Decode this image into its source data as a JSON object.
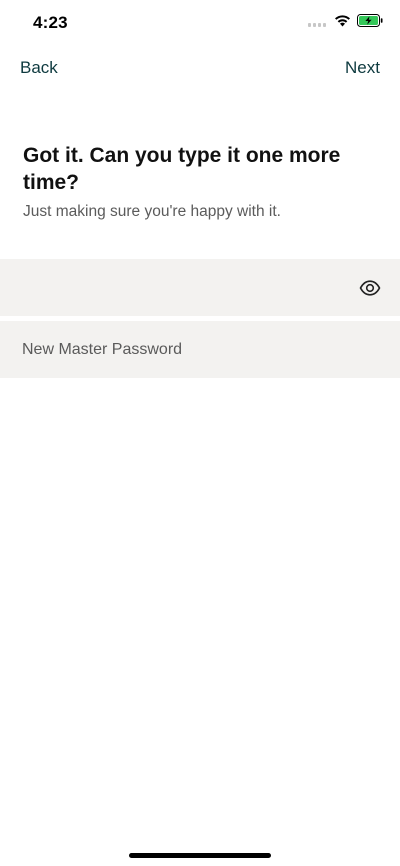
{
  "status_bar": {
    "time": "4:23"
  },
  "nav": {
    "back_label": "Back",
    "next_label": "Next"
  },
  "content": {
    "title": "Got it. Can you type it one more time?",
    "subtitle": "Just making sure you're happy with it."
  },
  "fields": {
    "confirm_password_value": "",
    "new_master_password_placeholder": "New Master Password"
  },
  "icons": {
    "signal": "cellular-signal-icon",
    "wifi": "wifi-icon",
    "battery": "battery-charging-icon",
    "eye": "eye-icon"
  },
  "colors": {
    "accent": "#0e3a3f",
    "field_background": "#f3f2f0",
    "battery_fill": "#34c759"
  }
}
